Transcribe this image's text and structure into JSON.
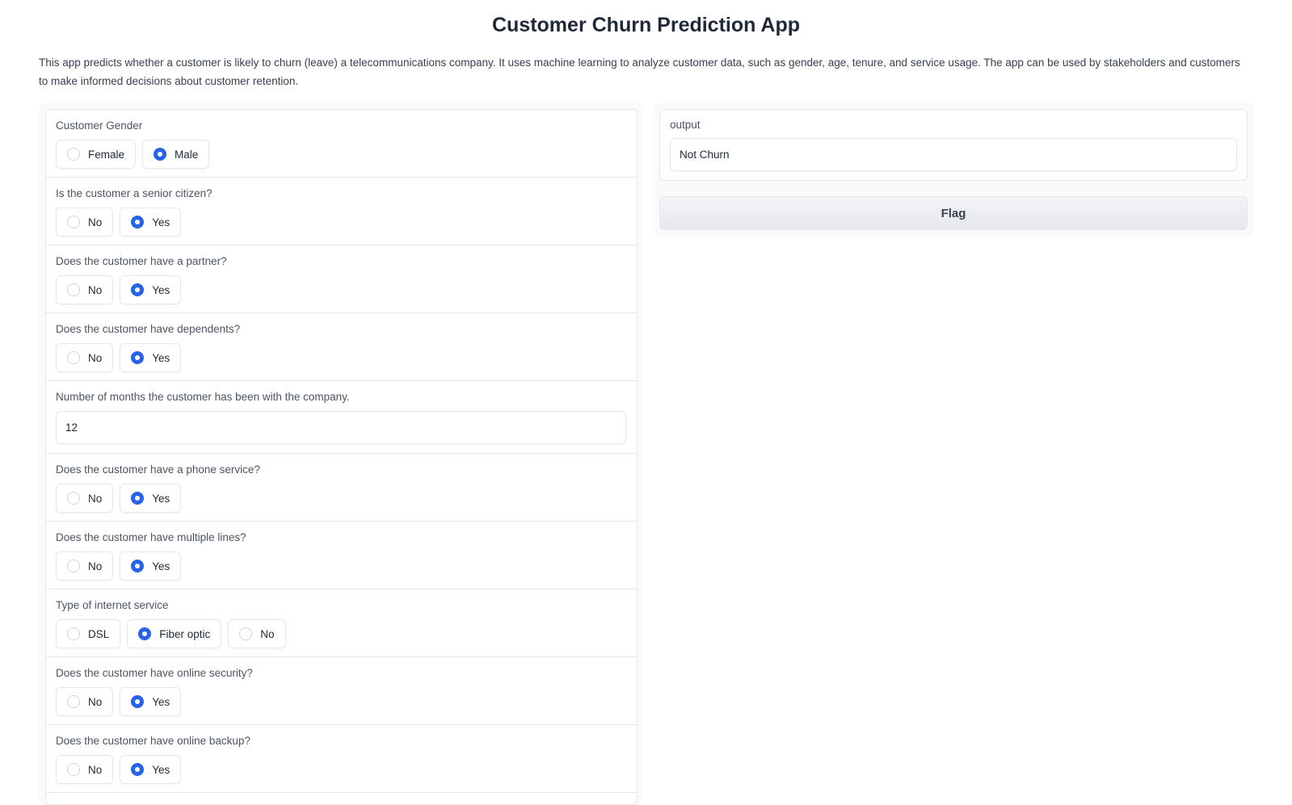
{
  "app": {
    "title": "Customer Churn Prediction App",
    "description": "This app predicts whether a customer is likely to churn (leave) a telecommunications company. It uses machine learning to analyze customer data, such as gender, age, tenure, and service usage. The app can be used by stakeholders and customers to make informed decisions about customer retention."
  },
  "form": {
    "gender": {
      "label": "Customer Gender",
      "options": [
        "Female",
        "Male"
      ],
      "selected": "Male"
    },
    "senior": {
      "label": "Is the customer a senior citizen?",
      "options": [
        "No",
        "Yes"
      ],
      "selected": "Yes"
    },
    "partner": {
      "label": "Does the customer have a partner?",
      "options": [
        "No",
        "Yes"
      ],
      "selected": "Yes"
    },
    "dependents": {
      "label": "Does the customer have dependents?",
      "options": [
        "No",
        "Yes"
      ],
      "selected": "Yes"
    },
    "tenure": {
      "label": "Number of months the customer has been with the company.",
      "value": "12"
    },
    "phone": {
      "label": "Does the customer have a phone service?",
      "options": [
        "No",
        "Yes"
      ],
      "selected": "Yes"
    },
    "multiple_lines": {
      "label": "Does the customer have multiple lines?",
      "options": [
        "No",
        "Yes"
      ],
      "selected": "Yes"
    },
    "internet": {
      "label": "Type of internet service",
      "options": [
        "DSL",
        "Fiber optic",
        "No"
      ],
      "selected": "Fiber optic"
    },
    "online_security": {
      "label": "Does the customer have online security?",
      "options": [
        "No",
        "Yes"
      ],
      "selected": "Yes"
    },
    "online_backup": {
      "label": "Does the customer have online backup?",
      "options": [
        "No",
        "Yes"
      ],
      "selected": "Yes"
    }
  },
  "output": {
    "label": "output",
    "value": "Not Churn"
  },
  "actions": {
    "flag_label": "Flag"
  },
  "colors": {
    "accent": "#2563eb",
    "border": "#e5e7eb",
    "panel_bg": "#f9fafb"
  }
}
